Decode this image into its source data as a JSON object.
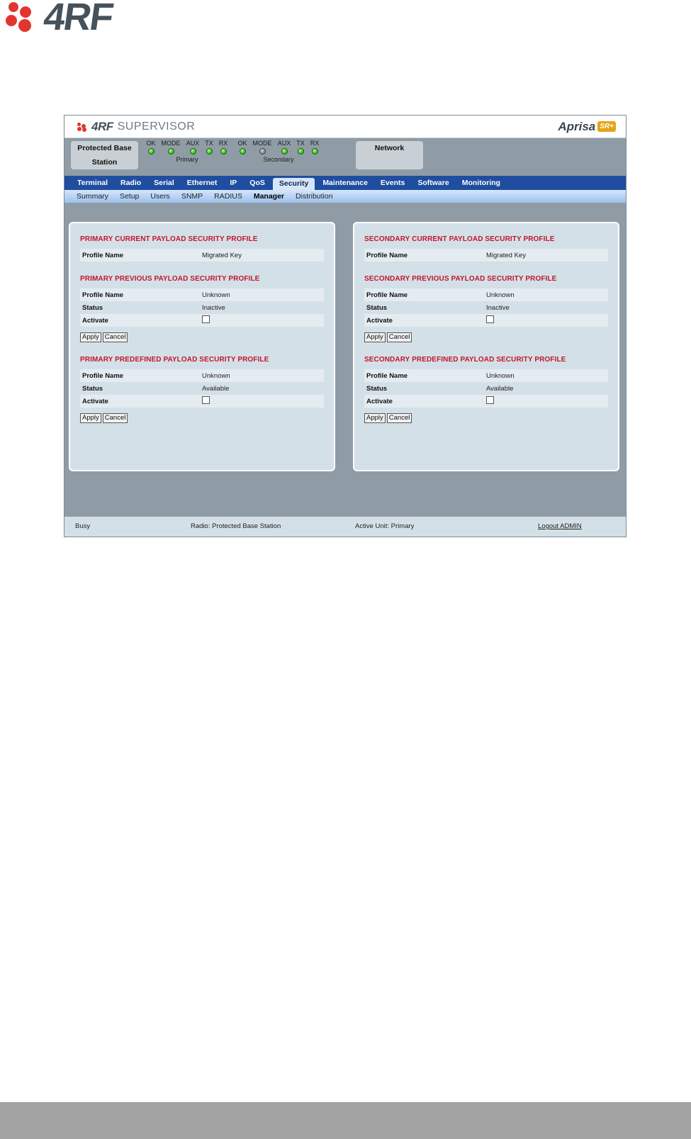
{
  "doc_logo": {
    "text": "4RF"
  },
  "app": {
    "brand": "4RF",
    "product": "SUPERVISOR",
    "model_word": "Aprisa",
    "model_badge": "SR+"
  },
  "status": {
    "station_line1": "Protected Base",
    "station_line2": "Station",
    "network": "Network",
    "primary": {
      "name": "Primary",
      "leds": [
        {
          "label": "OK",
          "state": "green"
        },
        {
          "label": "MODE",
          "state": "green"
        },
        {
          "label": "AUX",
          "state": "green"
        },
        {
          "label": "TX",
          "state": "green"
        },
        {
          "label": "RX",
          "state": "green"
        }
      ]
    },
    "secondary": {
      "name": "Secondary",
      "leds": [
        {
          "label": "OK",
          "state": "green"
        },
        {
          "label": "MODE",
          "state": "grey"
        },
        {
          "label": "AUX",
          "state": "green"
        },
        {
          "label": "TX",
          "state": "green"
        },
        {
          "label": "RX",
          "state": "green"
        }
      ]
    }
  },
  "nav": {
    "tabs": [
      "Terminal",
      "Radio",
      "Serial",
      "Ethernet",
      "IP",
      "QoS",
      "Security",
      "Maintenance",
      "Events",
      "Software",
      "Monitoring"
    ],
    "active": "Security"
  },
  "subnav": {
    "items": [
      "Summary",
      "Setup",
      "Users",
      "SNMP",
      "RADIUS",
      "Manager",
      "Distribution"
    ],
    "active": "Manager"
  },
  "labels": {
    "profile_name": "Profile Name",
    "status": "Status",
    "activate": "Activate",
    "apply": "Apply",
    "cancel": "Cancel"
  },
  "primary": {
    "current_title": "PRIMARY CURRENT PAYLOAD SECURITY PROFILE",
    "current_profile": "Migrated Key",
    "previous_title": "PRIMARY PREVIOUS PAYLOAD SECURITY PROFILE",
    "previous_profile": "Unknown",
    "previous_status": "Inactive",
    "predefined_title": "PRIMARY PREDEFINED PAYLOAD SECURITY PROFILE",
    "predefined_profile": "Unknown",
    "predefined_status": "Available"
  },
  "secondary": {
    "current_title": "SECONDARY CURRENT PAYLOAD SECURITY PROFILE",
    "current_profile": "Migrated Key",
    "previous_title": "SECONDARY PREVIOUS PAYLOAD SECURITY PROFILE",
    "previous_profile": "Unknown",
    "previous_status": "Inactive",
    "predefined_title": "SECONDARY PREDEFINED PAYLOAD SECURITY PROFILE",
    "predefined_profile": "Unknown",
    "predefined_status": "Available"
  },
  "footer": {
    "state": "Busy",
    "radio": "Radio: Protected Base Station",
    "active_unit": "Active Unit: Primary",
    "logout": "Logout ADMIN"
  }
}
